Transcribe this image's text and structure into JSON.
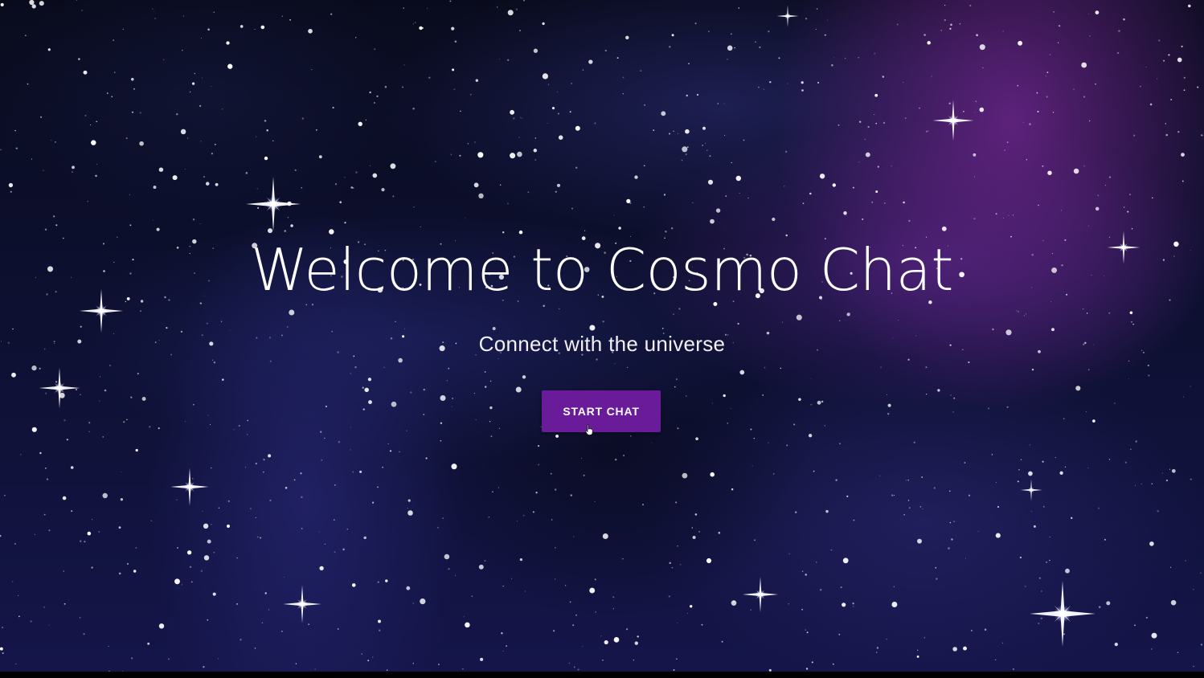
{
  "hero": {
    "title": "Welcome to Cosmo Chat",
    "subtitle": "Connect with the universe",
    "cta_label": "START CHAT"
  },
  "colors": {
    "background": "#090b1d",
    "nebula_purple": "#782896",
    "button": "#6a1b9a",
    "text": "#ffffff"
  },
  "icons": {
    "cursor": "hand-pointer-icon",
    "stars": "sparkle-star-icon"
  }
}
